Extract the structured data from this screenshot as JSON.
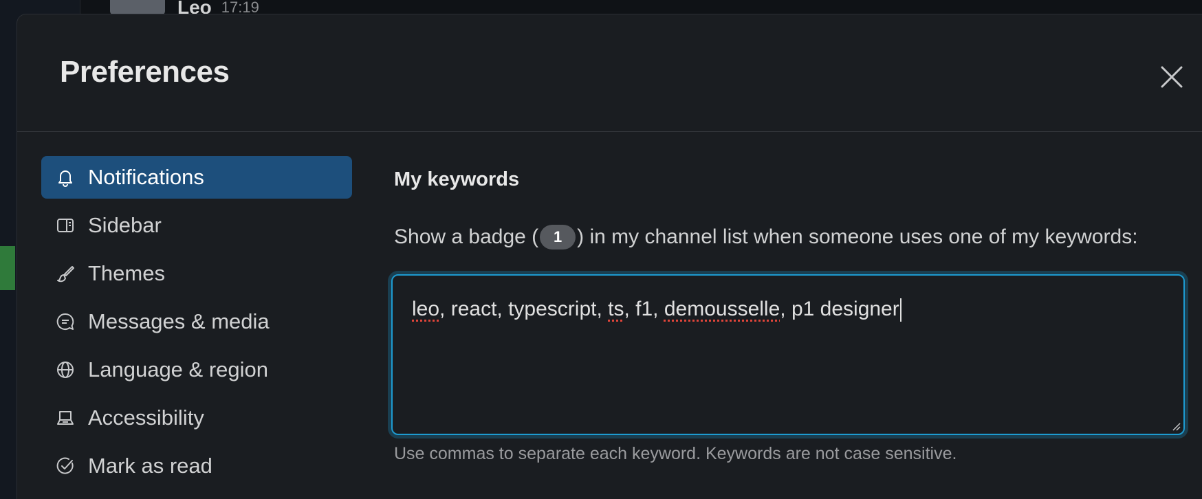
{
  "background": {
    "author": "Leo",
    "time": "17:19"
  },
  "modal": {
    "title": "Preferences",
    "close_icon": "close-icon"
  },
  "nav": {
    "items": [
      {
        "label": "Notifications",
        "icon": "bell-icon",
        "active": true
      },
      {
        "label": "Sidebar",
        "icon": "sidebar-icon",
        "active": false
      },
      {
        "label": "Themes",
        "icon": "brush-icon",
        "active": false
      },
      {
        "label": "Messages & media",
        "icon": "message-search-icon",
        "active": false
      },
      {
        "label": "Language & region",
        "icon": "globe-icon",
        "active": false
      },
      {
        "label": "Accessibility",
        "icon": "keyboard-icon",
        "active": false
      },
      {
        "label": "Mark as read",
        "icon": "check-circle-icon",
        "active": false
      }
    ]
  },
  "keywords": {
    "title": "My keywords",
    "description_before": "Show a badge (",
    "badge_count": "1",
    "description_after": ") in my channel list when someone uses one of my keywords:",
    "value_parts": [
      "leo",
      ", react, typescript, ",
      "ts",
      ", f1, ",
      "demousselle",
      ", p1 designer"
    ],
    "hint": "Use commas to separate each keyword. Keywords are not case sensitive."
  },
  "colors": {
    "accent": "#1d9bd1",
    "active_nav": "#1d4f7c",
    "background": "#1a1d21"
  }
}
